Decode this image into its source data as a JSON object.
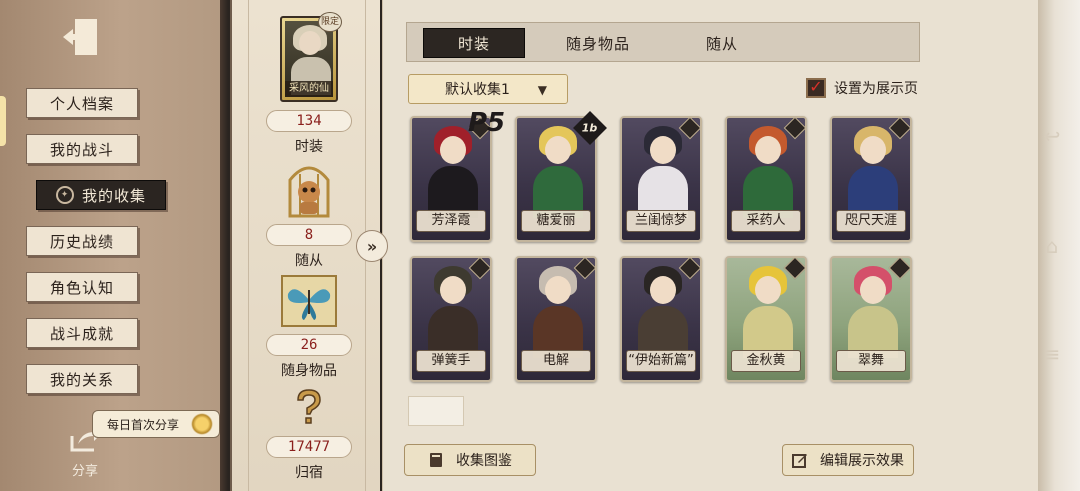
{
  "sidebar": {
    "tabs": [
      "个人档案",
      "我的战斗",
      "我的收集",
      "历史战绩",
      "角色认知",
      "战斗成就",
      "我的关系"
    ],
    "active_tab": "我的收集",
    "share_label": "分享",
    "share_tip": "每日首次分享"
  },
  "summary": {
    "costume_caption": "采风的仙灵",
    "limited_badge": "限定",
    "costume_count": "134",
    "costume_label": "时装",
    "pet_count": "8",
    "pet_label": "随从",
    "item_count": "26",
    "item_label": "随身物品",
    "home_count": "17477",
    "home_label": "归宿"
  },
  "main": {
    "tabs": [
      "时装",
      "随身物品",
      "随从"
    ],
    "active_tab": "时装",
    "collection_select": "默认收集1",
    "showcase_label": "设置为展示页",
    "cards": [
      {
        "name": "芳泽霞",
        "theme": "purple",
        "hair": "#a0202a",
        "body": "#1d1a1e"
      },
      {
        "name": "糖爱丽",
        "theme": "purple",
        "hair": "#e4c65a",
        "body": "#2f6a3c"
      },
      {
        "name": "兰闺惊梦",
        "theme": "purple",
        "hair": "#2b2a36",
        "body": "#e6e2e6"
      },
      {
        "name": "采药人",
        "theme": "purple",
        "hair": "#c45a2e",
        "body": "#2e6a3a"
      },
      {
        "name": "咫尺天涯",
        "theme": "purple",
        "hair": "#d8b66a",
        "body": "#2c3e7a"
      },
      {
        "name": "弹簧手",
        "theme": "purple",
        "hair": "#3e3a30",
        "body": "#3a2e28"
      },
      {
        "name": "电解",
        "theme": "purple",
        "hair": "#c6bcb0",
        "body": "#5a3626"
      },
      {
        "name": "“伊始新篇”",
        "theme": "purple",
        "hair": "#2a2624",
        "body": "#4a3e34"
      },
      {
        "name": "金秋黄",
        "theme": "green",
        "hair": "#e6c43a",
        "body": "#d2c98a"
      },
      {
        "name": "翠舞",
        "theme": "green",
        "hair": "#d4506a",
        "body": "#c8c48a"
      }
    ],
    "overlay_p5": "P5",
    "overlay_1b": "1b",
    "browse_button": "收集图鉴",
    "edit_button": "编辑展示效果"
  }
}
